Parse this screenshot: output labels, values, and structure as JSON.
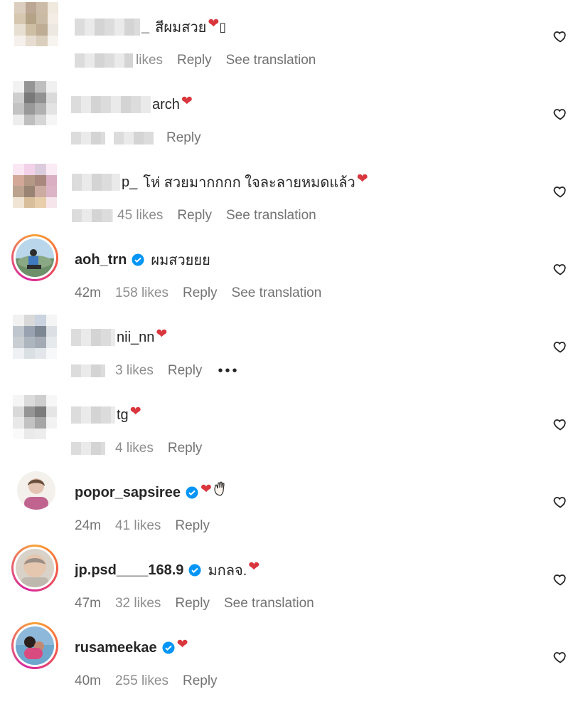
{
  "comments": [
    {
      "user": "_ ",
      "blur_name": true,
      "text": "สีผมสวย",
      "time": "",
      "likes": "likes",
      "reply": "Reply",
      "translation": "See translation",
      "avatar_colors": [
        "#d9c9b8",
        "#b49e88",
        "#c7b59e",
        "#efe7db",
        "#d2c3a8",
        "#ae9a7b",
        "#c4b39a",
        "#f2ece3",
        "#e5dccd",
        "#c9b89b",
        "#b7a589",
        "#ece6de",
        "#f4efe9",
        "#e4dacb",
        "#d7cab5",
        "#f7f3ef"
      ]
    },
    {
      "user": "arch",
      "blur_name": true,
      "text": "",
      "time": "",
      "likes": "",
      "reply": "Reply",
      "translation": "",
      "avatar_colors": [
        "#f1f1f1",
        "#8a8a8a",
        "#b8b8b8",
        "#efefef",
        "#c9c9c9",
        "#6b6b6b",
        "#878787",
        "#d6d6d6",
        "#bdbdbd",
        "#8f8f8f",
        "#a9a9a9",
        "#e1e1e1",
        "#ececec",
        "#b7b7b7",
        "#d2d2d2",
        "#f4f4f4"
      ]
    },
    {
      "user": "p_",
      "blur_name": true,
      "text": "โห่ สวยมากกกก ใจละลายหมดแล้ว",
      "time": "",
      "likes": "45 likes",
      "reply": "Reply",
      "translation": "See translation",
      "avatar_colors": [
        "#fbe5f2",
        "#f1cde7",
        "#d8c7da",
        "#fbe9f4",
        "#cf9f8f",
        "#ad8f7a",
        "#a07c70",
        "#d7a6bd",
        "#b59a85",
        "#8f7765",
        "#c7a397",
        "#d8aebf",
        "#efe3d0",
        "#d4b790",
        "#e6c9a3",
        "#f6e4e9"
      ]
    },
    {
      "user": "aoh_trn",
      "verified": true,
      "text": "ผมสวยยย",
      "time": "42m",
      "likes": "158 likes",
      "reply": "Reply",
      "translation": "See translation",
      "story": true
    },
    {
      "user": "nii_nn",
      "blur_name": true,
      "text": "",
      "time": "",
      "likes": "3 likes",
      "reply": "Reply",
      "more": "•••",
      "avatar_colors": [
        "#f0f0f0",
        "#d5d5d5",
        "#c5cfdc",
        "#f4f4f4",
        "#b9c0c8",
        "#8f99a8",
        "#6f7a88",
        "#d9dde2",
        "#c4c9cf",
        "#a5adb8",
        "#9ba2ac",
        "#e5e8eb",
        "#edf0f2",
        "#d7dce0",
        "#e1e5e9",
        "#f7f8fa"
      ]
    },
    {
      "user": "tg",
      "blur_name": true,
      "text": "",
      "time": "",
      "likes": "4 likes",
      "reply": "Reply",
      "avatar_colors": [
        "#f4f4f4",
        "#d8d8d8",
        "#c9c9c9",
        "#f7f7f7",
        "#d5d5d5",
        "#8a8a8a",
        "#6e6e6e",
        "#e3e3e3",
        "#e6e6e6",
        "#bcbcbc",
        "#9d9d9d",
        "#f1f1f1",
        "#fafafa",
        "#e8e8e8",
        "#ececec",
        "#ffffff"
      ]
    },
    {
      "user": "popor_sapsiree",
      "verified": true,
      "text": "",
      "time": "24m",
      "likes": "41 likes",
      "reply": "Reply",
      "plain_avatar": true
    },
    {
      "user": "jp.psd____168.9",
      "verified": true,
      "text": "มกลจ.",
      "time": "47m",
      "likes": "32 likes",
      "reply": "Reply",
      "translation": "See translation",
      "story": true
    },
    {
      "user": "rusameekae",
      "verified": true,
      "text": "",
      "time": "40m",
      "likes": "255 likes",
      "reply": "Reply",
      "story": true
    }
  ],
  "icons": {
    "heart": "heart-outline-icon",
    "verified": "verified-badge-icon",
    "emoji": "red-heart-emoji-icon",
    "hand": "waving-hand-emoji-icon"
  },
  "colors": {
    "text_primary": "#262626",
    "text_secondary": "#737373",
    "verified_blue": "#0095f6",
    "emoji_red": "#d9363e"
  }
}
